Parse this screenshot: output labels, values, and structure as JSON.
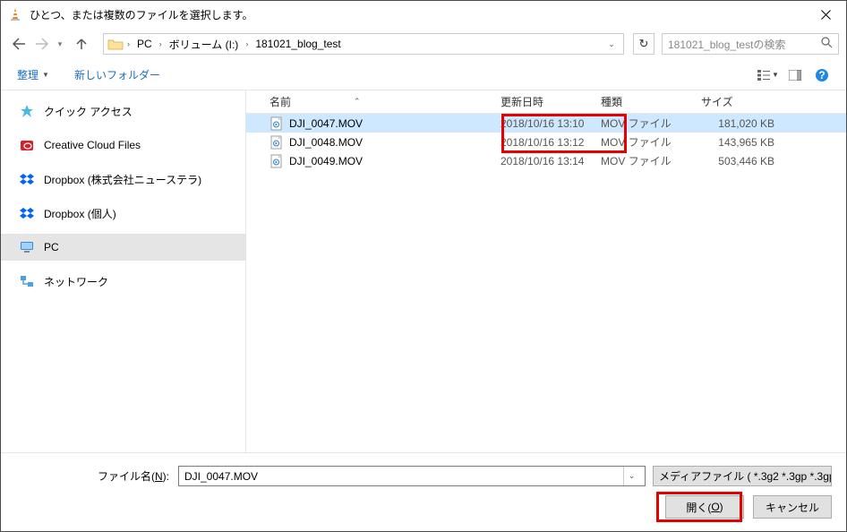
{
  "title": "ひとつ、または複数のファイルを選択します。",
  "breadcrumbs": {
    "pc": "PC",
    "vol": "ボリューム (I:)",
    "folder": "181021_blog_test"
  },
  "search_placeholder": "181021_blog_testの検索",
  "toolbar": {
    "organize": "整理",
    "newfolder": "新しいフォルダー"
  },
  "sidebar": {
    "items": [
      {
        "label": "クイック アクセス"
      },
      {
        "label": "Creative Cloud Files"
      },
      {
        "label": "Dropbox (株式会社ニューステラ)"
      },
      {
        "label": "Dropbox (個人)"
      },
      {
        "label": "PC"
      },
      {
        "label": "ネットワーク"
      }
    ]
  },
  "columns": {
    "name": "名前",
    "date": "更新日時",
    "type": "種類",
    "size": "サイズ"
  },
  "files": [
    {
      "name": "DJI_0047.MOV",
      "date": "2018/10/16 13:10",
      "type": "MOV ファイル",
      "size": "181,020 KB",
      "selected": true
    },
    {
      "name": "DJI_0048.MOV",
      "date": "2018/10/16 13:12",
      "type": "MOV ファイル",
      "size": "143,965 KB",
      "selected": false
    },
    {
      "name": "DJI_0049.MOV",
      "date": "2018/10/16 13:14",
      "type": "MOV ファイル",
      "size": "503,446 KB",
      "selected": false
    }
  ],
  "footer": {
    "filename_label_pre": "ファイル名(",
    "filename_label_u": "N",
    "filename_label_post": "):",
    "filename_value": "DJI_0047.MOV",
    "filter": "メディアファイル ( *.3g2 *.3gp *.3gp",
    "open_pre": "開く(",
    "open_u": "O",
    "open_post": ")",
    "cancel": "キャンセル"
  }
}
